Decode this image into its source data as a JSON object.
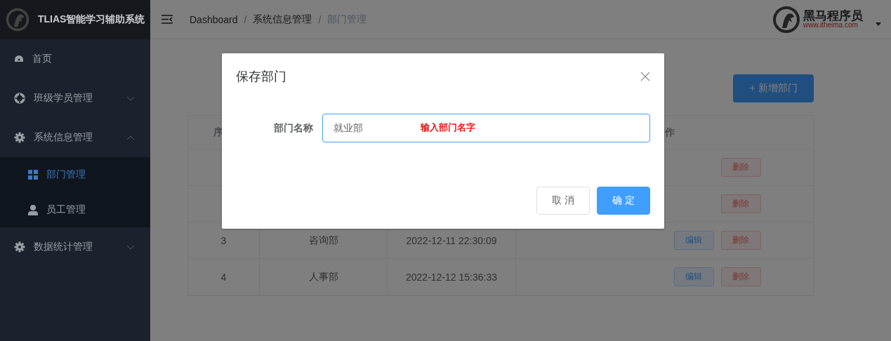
{
  "app_title": "TLIAS智能学习辅助系统",
  "sidebar": {
    "items": [
      {
        "label": "首页",
        "selected": false
      },
      {
        "label": "班级学员管理",
        "expanded": false,
        "selected": false
      },
      {
        "label": "系统信息管理",
        "expanded": true,
        "selected": false,
        "children": [
          {
            "label": "部门管理",
            "selected": true
          },
          {
            "label": "员工管理",
            "selected": false
          }
        ]
      },
      {
        "label": "数据统计管理",
        "expanded": false,
        "selected": false
      }
    ]
  },
  "breadcrumb": [
    {
      "kind": "link",
      "text": "Dashboard"
    },
    {
      "kind": "separator",
      "text": "/"
    },
    {
      "kind": "link",
      "text": "系统信息管理"
    },
    {
      "kind": "separator",
      "text": "/"
    },
    {
      "kind": "current",
      "text": "部门管理"
    }
  ],
  "brand": {
    "name": "黑马程序员",
    "url": "www.itheima.com"
  },
  "add_button": "+ 新增部门",
  "table": {
    "column_1": "序",
    "column_4": "作",
    "rows": [
      {
        "actions": [
          "删除"
        ]
      },
      {
        "actions": [
          "删除"
        ]
      },
      {
        "index": "3",
        "name": "咨询部",
        "time": "2022-12-11 22:30:09",
        "actions": [
          "编辑",
          "删除"
        ]
      },
      {
        "index": "4",
        "name": "人事部",
        "time": "2022-12-12 15:36:33",
        "actions": [
          "编辑",
          "删除"
        ]
      }
    ]
  },
  "dialog": {
    "title": "保存部门",
    "field_label": "部门名称",
    "field_value": "就业部",
    "annotation": "输入部门名字",
    "buttons": [
      {
        "label": "取 消",
        "kind": "default"
      },
      {
        "label": "确 定",
        "kind": "primary"
      }
    ]
  }
}
